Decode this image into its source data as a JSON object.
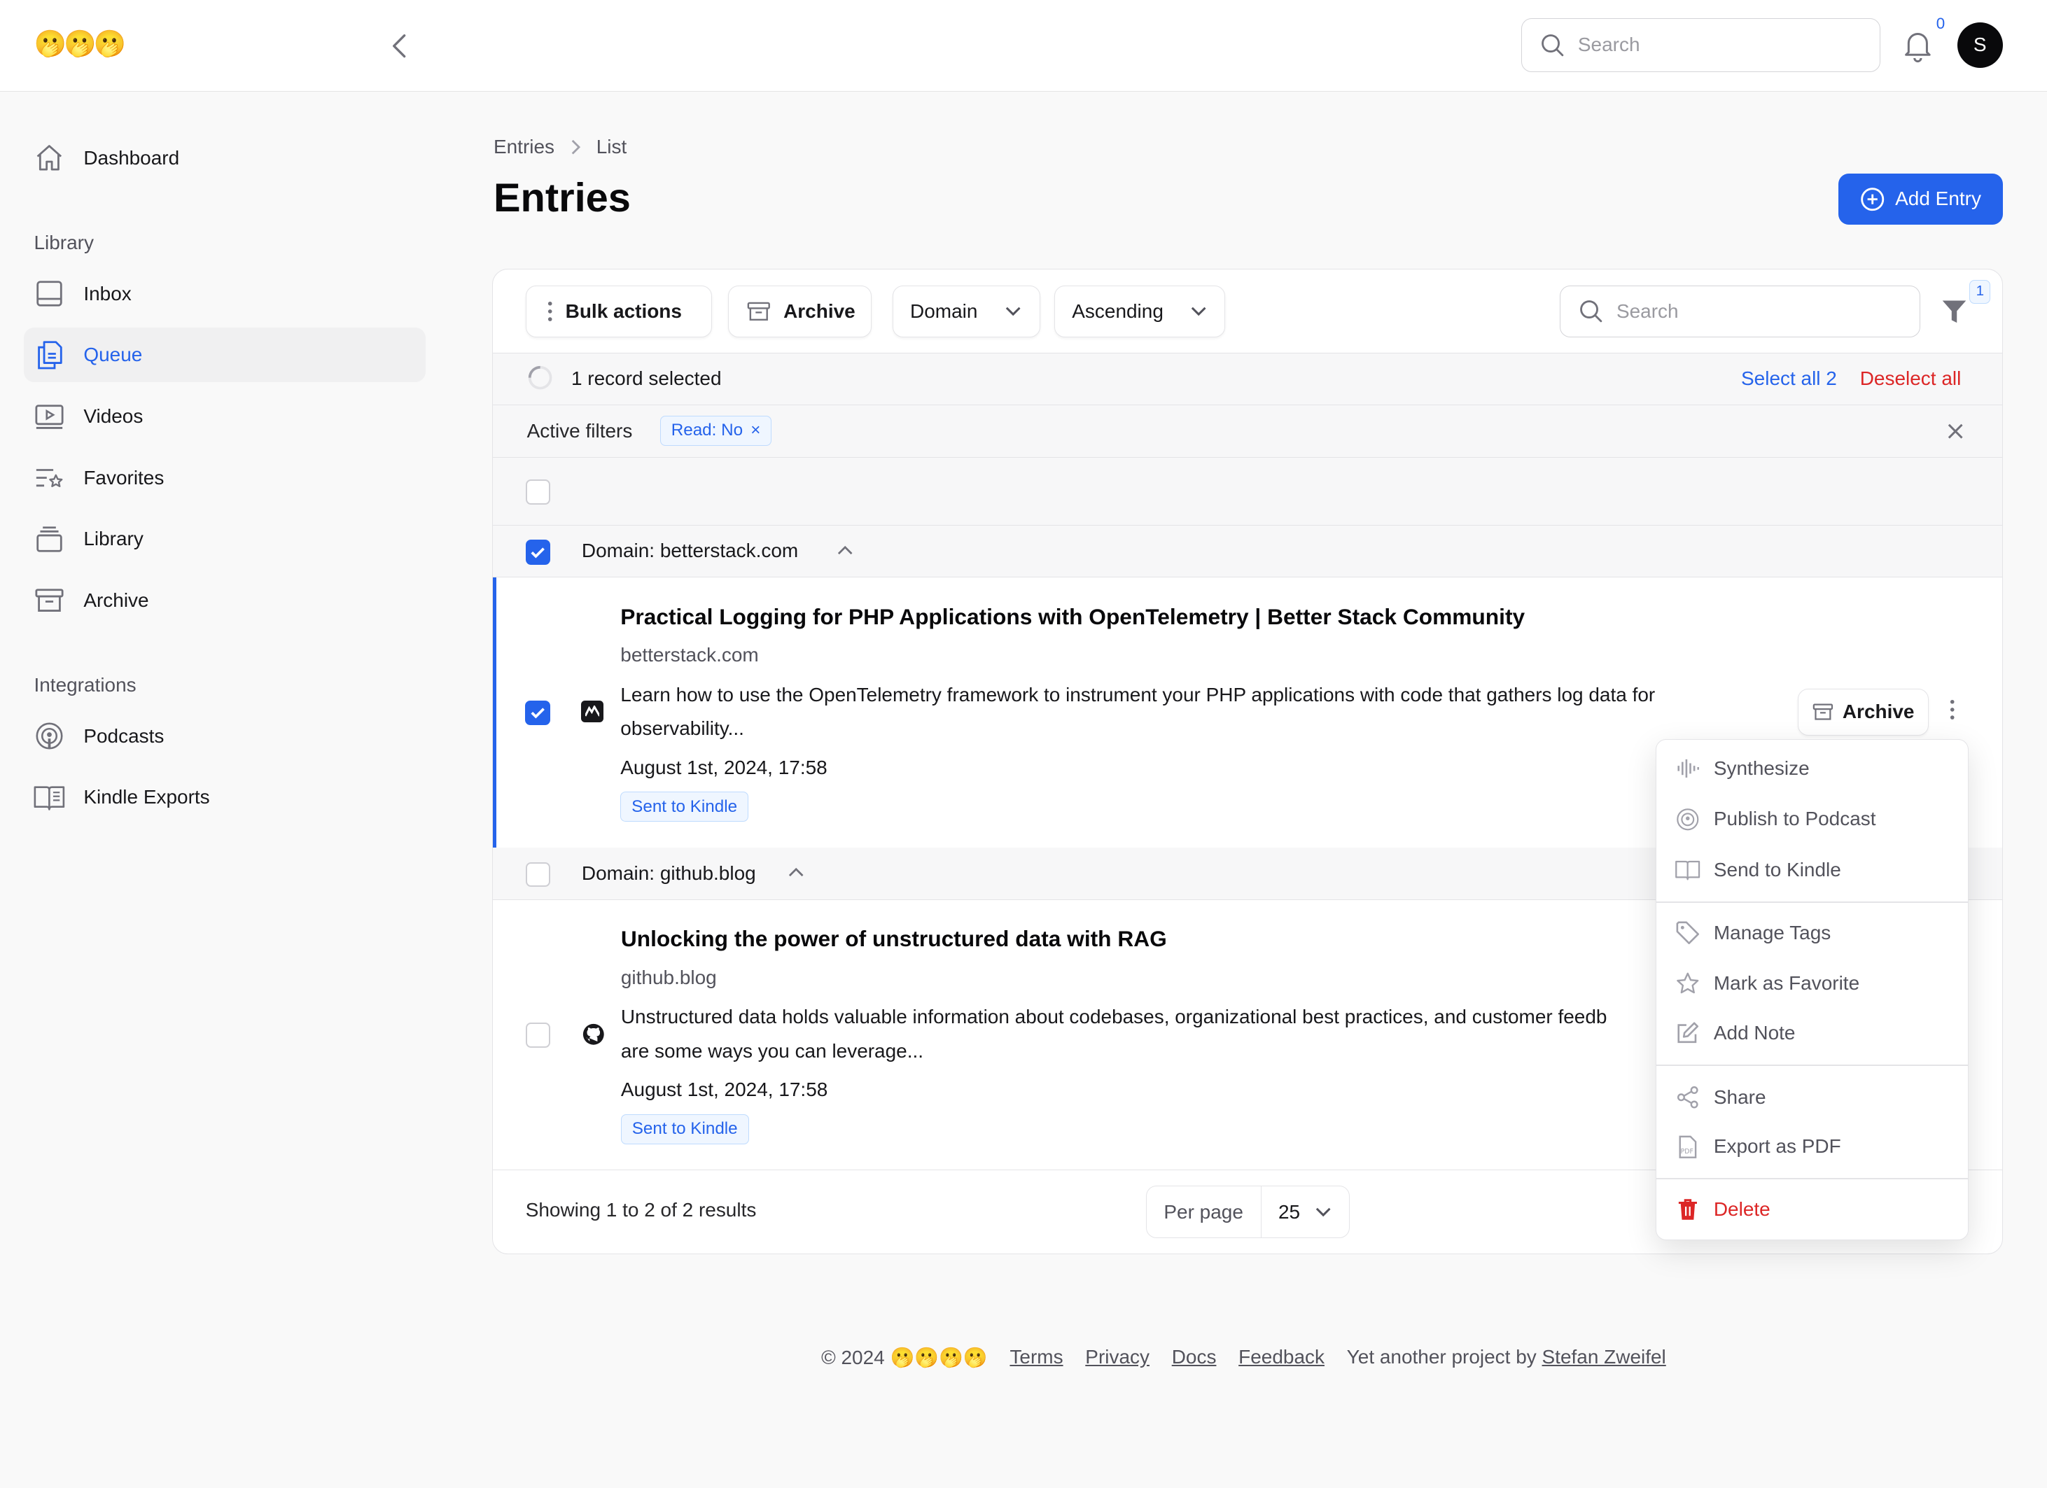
{
  "app": {
    "logo": "🫢🫢🫢"
  },
  "topbar": {
    "search_placeholder": "Search",
    "notifications_count": "0",
    "avatar_initial": "S"
  },
  "sidebar": {
    "top_items": [
      {
        "label": "Dashboard",
        "icon": "home-icon"
      }
    ],
    "library_group": "Library",
    "library_items": [
      {
        "label": "Inbox",
        "icon": "inbox-icon"
      },
      {
        "label": "Queue",
        "icon": "queue-icon",
        "active": true
      },
      {
        "label": "Videos",
        "icon": "video-icon"
      },
      {
        "label": "Favorites",
        "icon": "favorites-icon"
      },
      {
        "label": "Library",
        "icon": "library-icon"
      },
      {
        "label": "Archive",
        "icon": "archive-icon"
      }
    ],
    "integrations_group": "Integrations",
    "integration_items": [
      {
        "label": "Podcasts",
        "icon": "podcast-icon"
      },
      {
        "label": "Kindle Exports",
        "icon": "book-icon"
      }
    ]
  },
  "breadcrumb": {
    "first": "Entries",
    "second": "List"
  },
  "page": {
    "title": "Entries",
    "add_button": "Add Entry",
    "accent": "#2563eb"
  },
  "toolbar": {
    "bulk_actions": "Bulk actions",
    "archive": "Archive",
    "group_select": "Domain",
    "sort_select": "Ascending",
    "search_placeholder": "Search",
    "filter_count": "1"
  },
  "selection": {
    "text": "1 record selected",
    "select_all": "Select all 2",
    "deselect_all": "Deselect all"
  },
  "filters": {
    "label": "Active filters",
    "chips": [
      "Read: No"
    ]
  },
  "groups": [
    {
      "label": "Domain: betterstack.com",
      "checked": true,
      "entries": [
        {
          "title": "Practical Logging for PHP Applications with OpenTelemetry | Better Stack Community",
          "domain": "betterstack.com",
          "description": "Learn how to use the OpenTelemetry framework to instrument your PHP applications with code that gathers log data for observability...",
          "date": "August 1st, 2024, 17:58",
          "badge": "Sent to Kindle",
          "checked": true,
          "archive_label": "Archive"
        }
      ]
    },
    {
      "label": "Domain: github.blog",
      "checked": false,
      "entries": [
        {
          "title": "Unlocking the power of unstructured data with RAG",
          "domain": "github.blog",
          "description": "Unstructured data holds valuable information about codebases, organizational best practices, and customer feedb… are some ways you can leverage...",
          "description_line1": "Unstructured data holds valuable information about codebases, organizational best practices, and customer feedb",
          "description_line2": "are some ways you can leverage...",
          "date": "August 1st, 2024, 17:58",
          "badge": "Sent to Kindle",
          "checked": false
        }
      ]
    }
  ],
  "context_menu": {
    "items": [
      {
        "label": "Synthesize",
        "icon": "waveform-icon"
      },
      {
        "label": "Publish to Podcast",
        "icon": "podcast-icon"
      },
      {
        "label": "Send to Kindle",
        "icon": "book-icon"
      },
      {
        "label": "Manage Tags",
        "icon": "tag-icon"
      },
      {
        "label": "Mark as Favorite",
        "icon": "star-icon"
      },
      {
        "label": "Add Note",
        "icon": "pencil-icon"
      },
      {
        "label": "Share",
        "icon": "share-icon"
      },
      {
        "label": "Export as PDF",
        "icon": "pdf-icon"
      },
      {
        "label": "Delete",
        "icon": "trash-icon"
      }
    ]
  },
  "pagination": {
    "summary": "Showing 1 to 2 of 2 results",
    "per_page_label": "Per page",
    "per_page_value": "25"
  },
  "footer": {
    "copyright": "© 2024 🫢🫢🫢🫢",
    "terms": "Terms",
    "privacy": "Privacy",
    "docs": "Docs",
    "feedback": "Feedback",
    "credit_prefix": "Yet another project by",
    "author": "Stefan Zweifel"
  }
}
